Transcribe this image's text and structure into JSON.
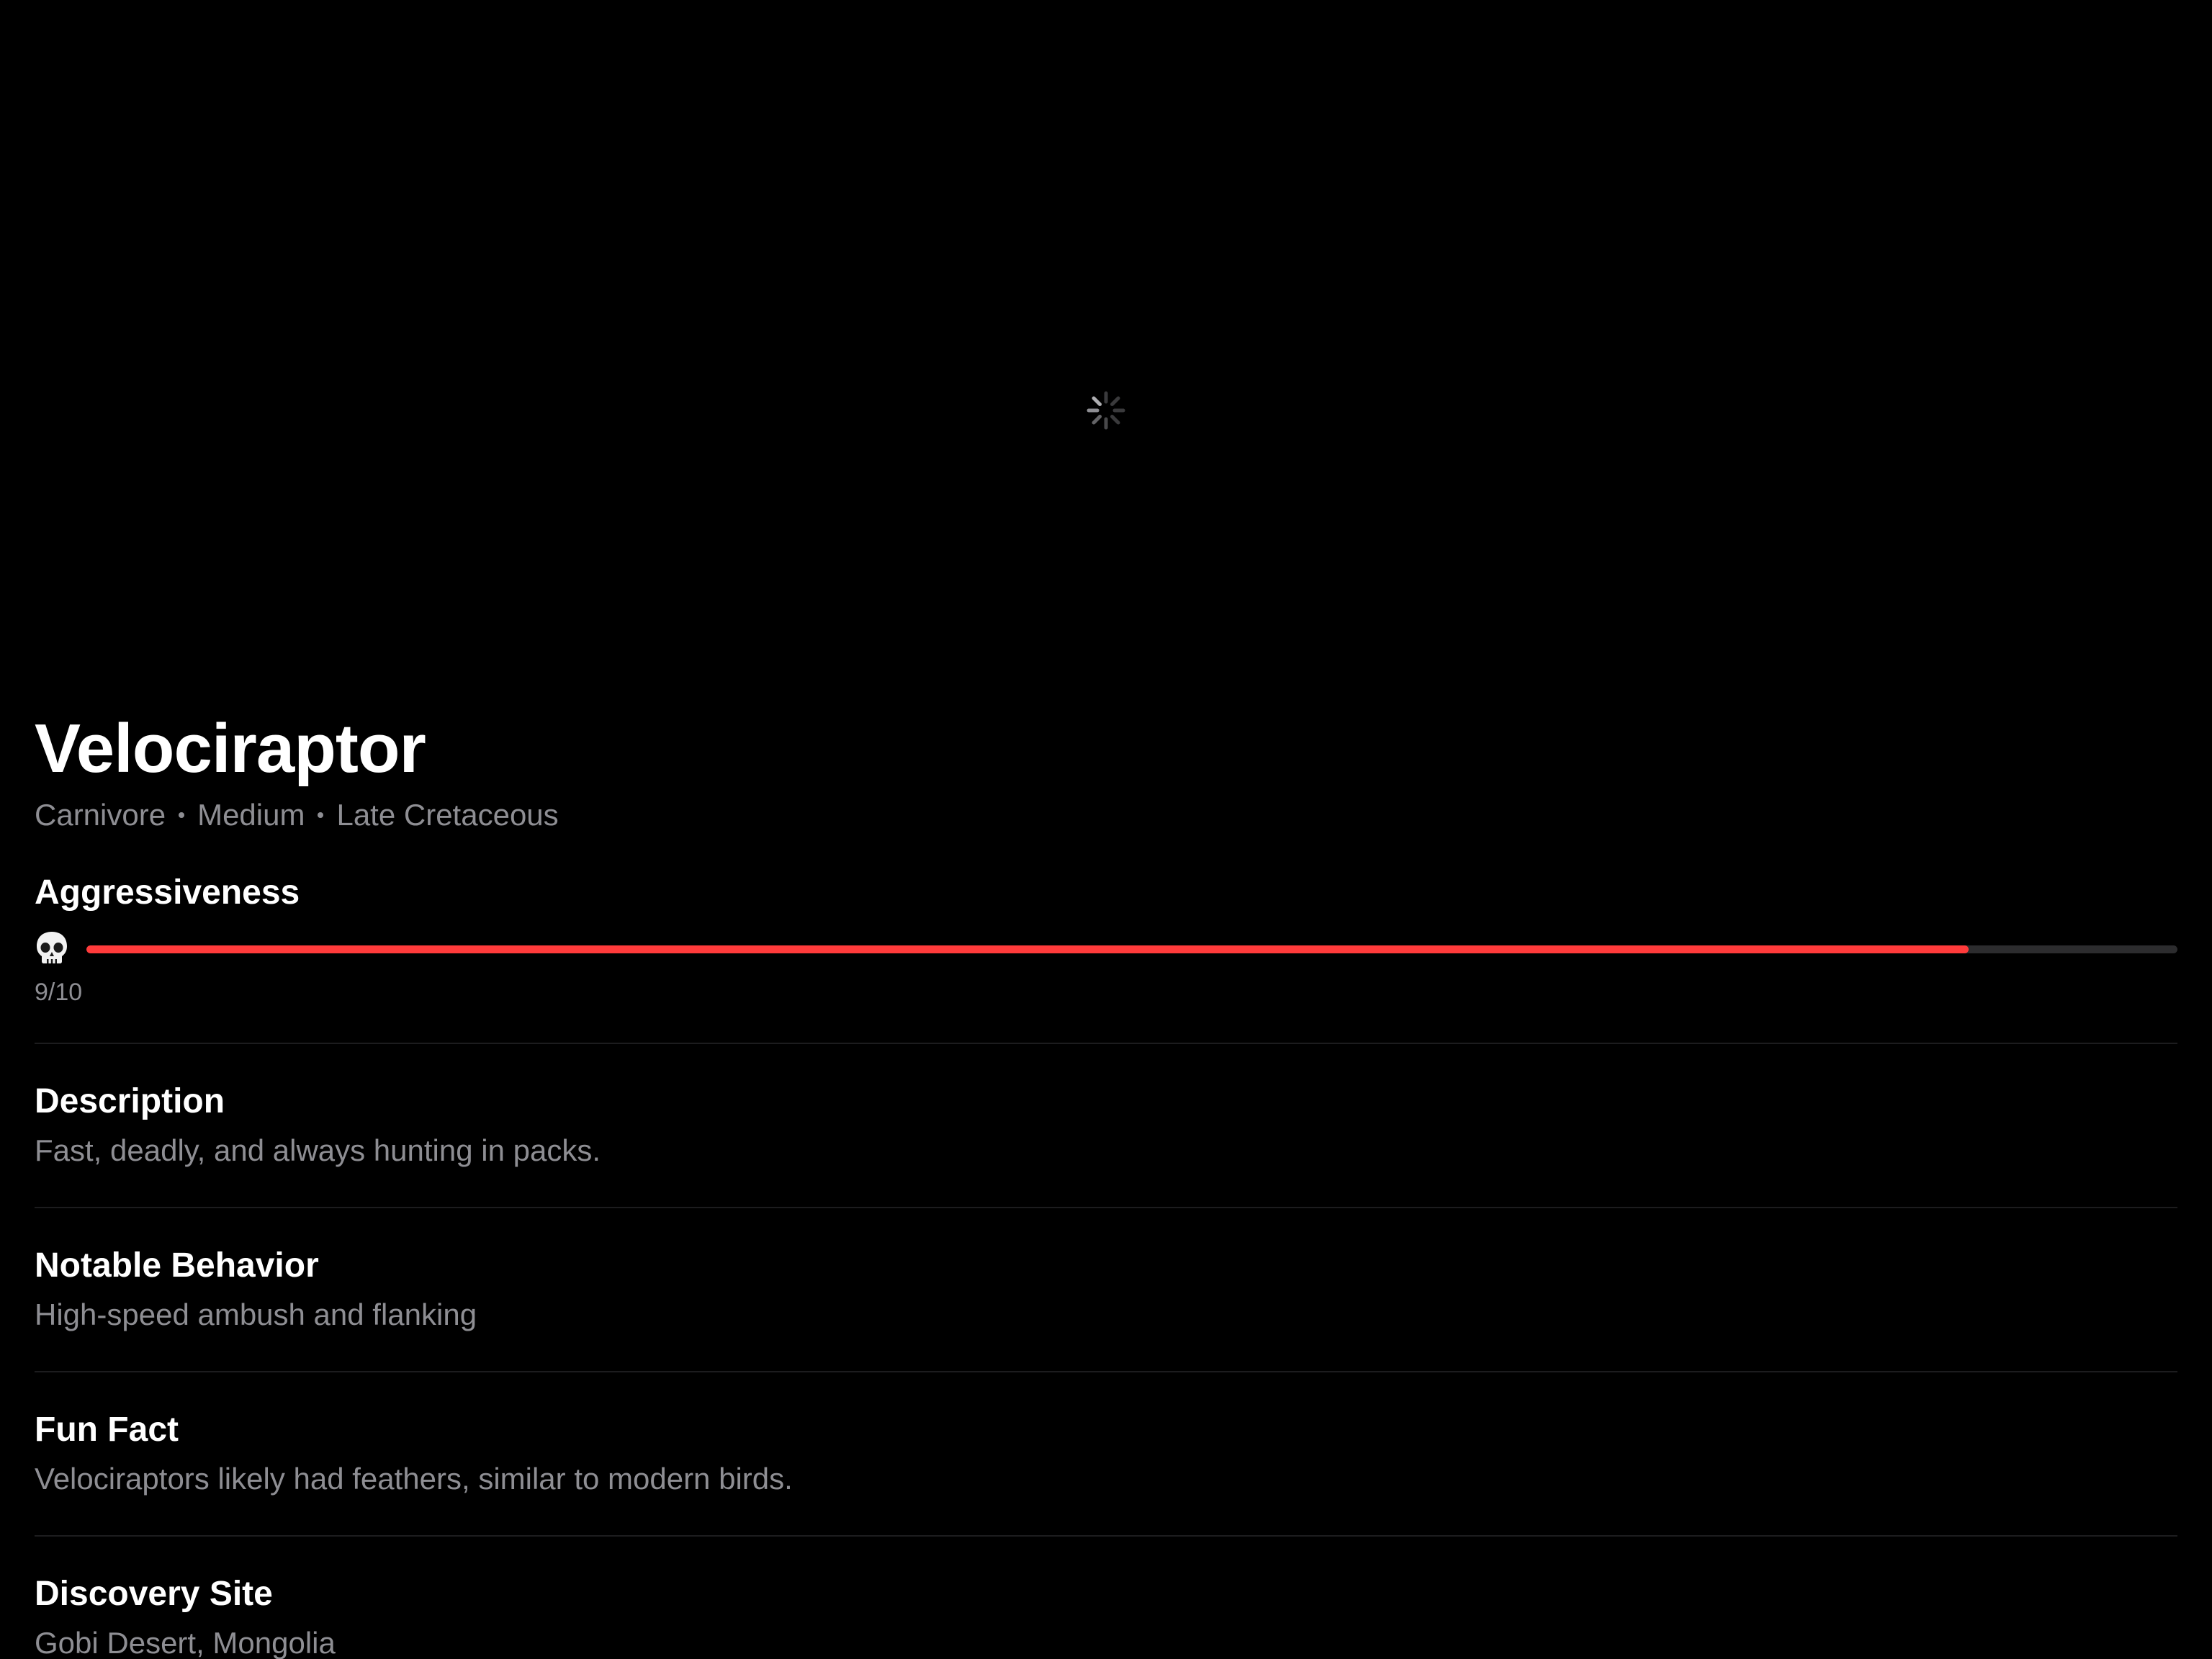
{
  "hero": {
    "loading_icon": "activity-spinner-icon"
  },
  "dinosaur": {
    "name": "Velociraptor",
    "tags": [
      "Carnivore",
      "Medium",
      "Late Cretaceous"
    ]
  },
  "aggressiveness": {
    "label": "Aggressiveness",
    "icon": "skull-icon",
    "value": 9,
    "max": 10,
    "value_text": "9/10",
    "bar_color": "#ff3b3b",
    "track_color": "#2c2c2e"
  },
  "sections": [
    {
      "title": "Description",
      "body": "Fast, deadly, and always hunting in packs."
    },
    {
      "title": "Notable Behavior",
      "body": "High-speed ambush and flanking"
    },
    {
      "title": "Fun Fact",
      "body": "Velociraptors likely had feathers, similar to modern birds."
    },
    {
      "title": "Discovery Site",
      "body": "Gobi Desert, Mongolia"
    }
  ]
}
